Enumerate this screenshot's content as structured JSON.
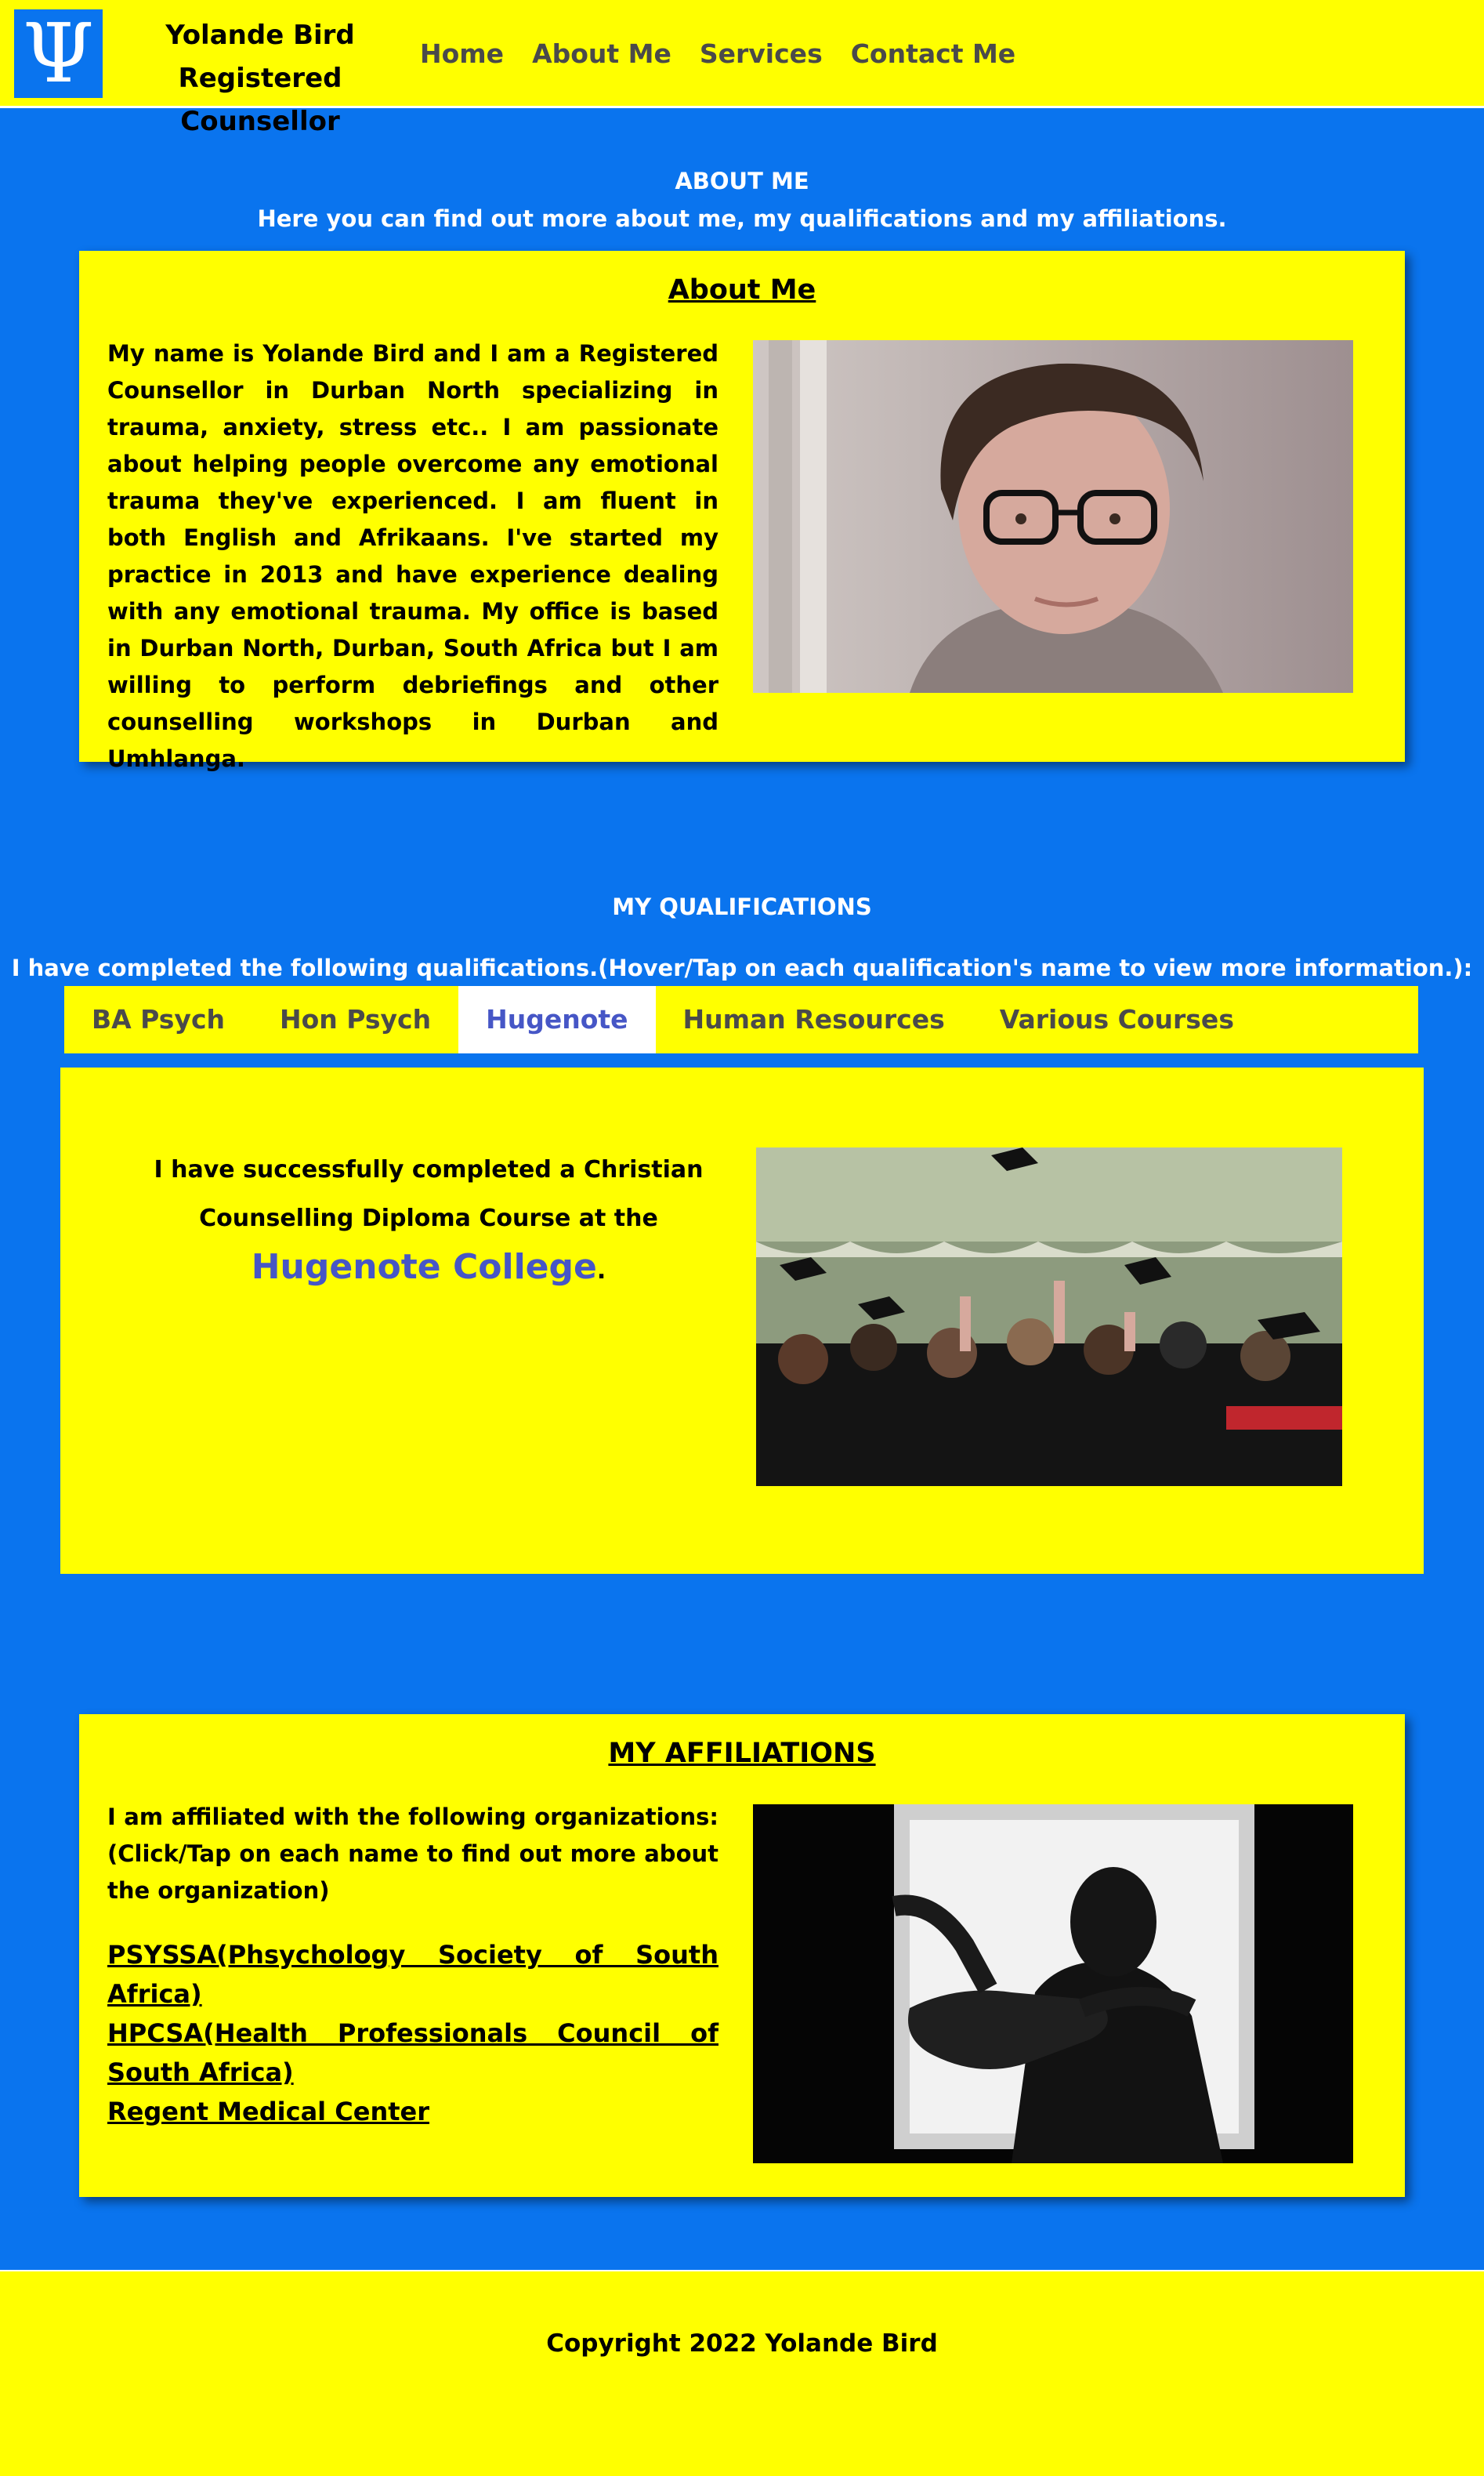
{
  "header": {
    "logo_glyph": "Ψ",
    "logo_icon": "psi-icon",
    "brand_name": "Yolande Bird",
    "brand_title": "Registered Counsellor",
    "nav": [
      "Home",
      "About Me",
      "Services",
      "Contact Me"
    ]
  },
  "about": {
    "section_title": "ABOUT ME",
    "section_subtitle": "Here you can find out more about me, my qualifications and my affiliations.",
    "card_title": "About Me",
    "paragraph": "My name is Yolande Bird and I am a Registered Counsellor in Durban North specializing in trauma, anxiety, stress etc.. I am passionate about helping people overcome any emotional trauma they've experienced. I am fluent in both English and Afrikaans. I've started my practice in 2013 and have experience dealing with any emotional trauma. My office is based in Durban North, Durban, South Africa but I am willing to perform debriefings and other counselling workshops in Durban and Umhlanga."
  },
  "qualifications": {
    "section_title": "MY QUALIFICATIONS",
    "section_subtitle": "I have completed the following qualifications.(Hover/Tap on each qualification's name to view more information.):",
    "tabs": [
      "BA Psych",
      "Hon Psych",
      "Hugenote",
      "Human Resources",
      "Various Courses"
    ],
    "active_tab": "Hugenote",
    "panel_text_before": "I have successfully completed a Christian Counselling Diploma Course at the",
    "panel_link": "Hugenote College",
    "panel_text_after": "."
  },
  "affiliations": {
    "card_title": "MY AFFILIATIONS",
    "paragraph": "I am affiliated with the following organizations: (Click/Tap on each name to find out more about the organization)",
    "links": [
      "PSYSSA(Phsychology Society of South Africa)",
      "HPCSA(Health Professionals Council of South Africa)",
      "Regent Medical Center"
    ]
  },
  "footer": {
    "copyright": "Copyright 2022 Yolande Bird"
  },
  "colors": {
    "background": "#0a74ee",
    "panel": "#ffff00",
    "nav_text": "#4a4a4a",
    "active_tab_text": "#4656c6"
  }
}
